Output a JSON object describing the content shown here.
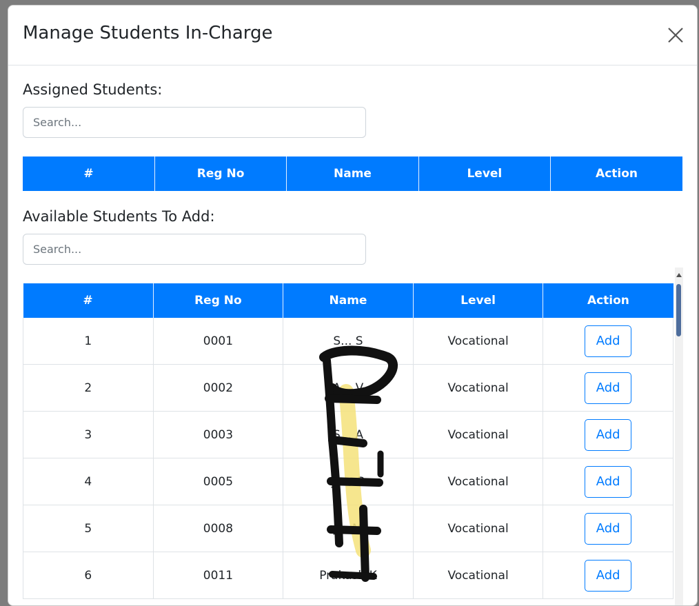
{
  "modal": {
    "title": "Manage Students In-Charge"
  },
  "assigned": {
    "label": "Assigned Students:",
    "search_placeholder": "Search...",
    "columns": [
      "#",
      "Reg No",
      "Name",
      "Level",
      "Action"
    ]
  },
  "available": {
    "label": "Available Students To Add:",
    "search_placeholder": "Search...",
    "columns": [
      "#",
      "Reg No",
      "Name",
      "Level",
      "Action"
    ],
    "rows": [
      {
        "num": "1",
        "reg": "0001",
        "name": "S... S",
        "level": "Vocational",
        "action": "Add"
      },
      {
        "num": "2",
        "reg": "0002",
        "name": "A... V",
        "level": "Vocational",
        "action": "Add"
      },
      {
        "num": "3",
        "reg": "0003",
        "name": "S... A",
        "level": "Vocational",
        "action": "Add"
      },
      {
        "num": "4",
        "reg": "0005",
        "name": "Ja... P",
        "level": "Vocational",
        "action": "Add"
      },
      {
        "num": "5",
        "reg": "0008",
        "name": "J... M",
        "level": "Vocational",
        "action": "Add"
      },
      {
        "num": "6",
        "reg": "0011",
        "name": "Prakash K",
        "level": "Vocational",
        "action": "Add"
      }
    ]
  },
  "colors": {
    "header_bg": "#007bff",
    "accent": "#007bff",
    "redaction_ink": "#111111",
    "highlight": "#f5e27a"
  }
}
